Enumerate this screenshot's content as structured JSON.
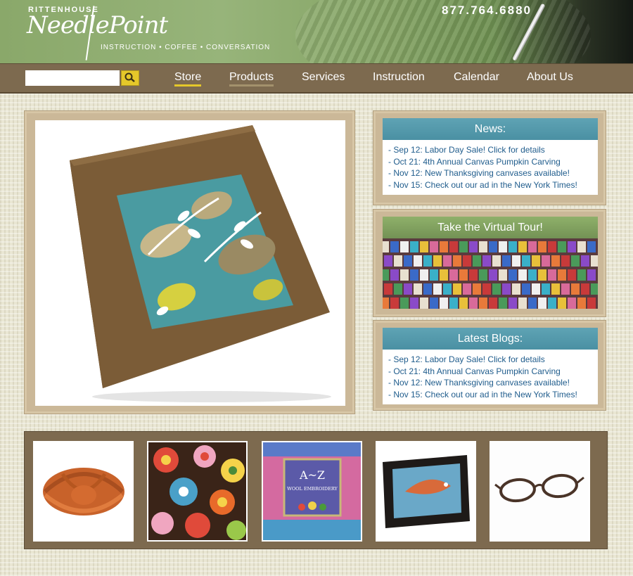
{
  "header": {
    "logo_top": "RITTENHOUSE",
    "logo_main": "NeedlePoint",
    "logo_tagline": "INSTRUCTION • COFFEE • CONVERSATION",
    "phone": "877.764.6880"
  },
  "nav": {
    "search_placeholder": "",
    "items": [
      {
        "label": "Store"
      },
      {
        "label": "Products"
      },
      {
        "label": "Services"
      },
      {
        "label": "Instruction"
      },
      {
        "label": "Calendar"
      },
      {
        "label": "About Us"
      }
    ]
  },
  "news": {
    "title": "News:",
    "items": [
      "- Sep 12: Labor Day Sale! Click for details",
      "- Oct 21: 4th Annual Canvas Pumpkin Carving",
      "- Nov 12: New Thanksgiving canvases available!",
      "- Nov 15: Check out our ad in the New York Times!"
    ]
  },
  "tour": {
    "title": "Take the Virtual Tour!"
  },
  "blogs": {
    "title": "Latest Blogs:",
    "items": [
      "- Sep 12: Labor Day Sale! Click for details",
      "- Oct 21: 4th Annual Canvas Pumpkin Carving",
      "- Nov 12: New Thanksgiving canvases available!",
      "- Nov 15: Check out our ad in the New York Times!"
    ]
  },
  "thumbs": {
    "book_title": "A~Z",
    "book_subtitle": "WOOL EMBROIDERY"
  },
  "colors": {
    "nav_bg": "#7d6a4f",
    "accent_yellow": "#e5c82a",
    "news_title_bg": "#5fa3b4",
    "tour_title_bg": "#8fb06a",
    "link_blue": "#1f5c8c"
  }
}
